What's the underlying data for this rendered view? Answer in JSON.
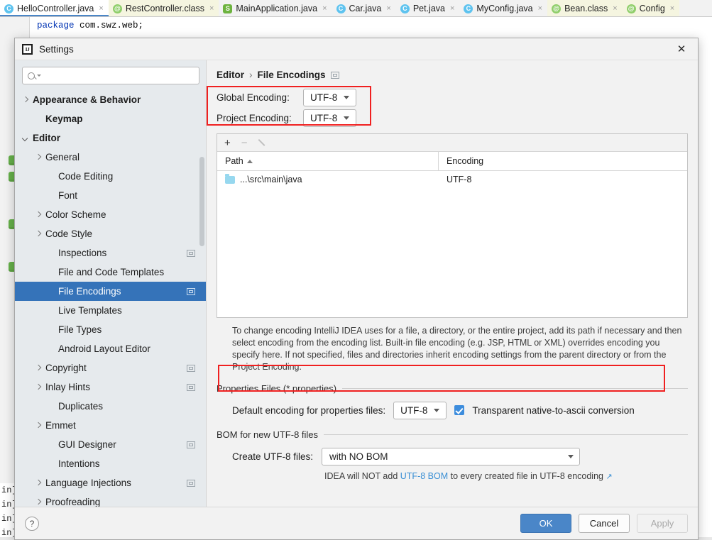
{
  "ide": {
    "tabs": [
      {
        "label": "HelloController.java",
        "icon": "class-c-icon",
        "kind": "java-active"
      },
      {
        "label": "RestController.class",
        "icon": "annotation-at-icon",
        "kind": "cls"
      },
      {
        "label": "MainApplication.java",
        "icon": "spring-boot-icon",
        "kind": "plain"
      },
      {
        "label": "Car.java",
        "icon": "class-c-icon",
        "kind": "plain"
      },
      {
        "label": "Pet.java",
        "icon": "class-c-icon",
        "kind": "plain"
      },
      {
        "label": "MyConfig.java",
        "icon": "class-c-icon",
        "kind": "plain"
      },
      {
        "label": "Bean.class",
        "icon": "annotation-at-icon",
        "kind": "cls"
      },
      {
        "label": "Config",
        "icon": "annotation-at-icon",
        "kind": "cls"
      }
    ],
    "close_glyph": "×",
    "code": {
      "keyword": "package",
      "rest": " com.swz.web;"
    },
    "console_lines": [
      "in]",
      "in]",
      "in]",
      "in]"
    ]
  },
  "dialog": {
    "title": "Settings",
    "logo_text": "IJ",
    "close_glyph": "✕"
  },
  "search": {
    "value": "",
    "placeholder": ""
  },
  "sidebar": {
    "items": [
      {
        "label": "Appearance & Behavior",
        "arrow": "right",
        "indent": 0,
        "bold": true,
        "badge": false,
        "selected": false
      },
      {
        "label": "Keymap",
        "arrow": "none",
        "indent": 1,
        "bold": true,
        "badge": false,
        "selected": false
      },
      {
        "label": "Editor",
        "arrow": "down",
        "indent": 0,
        "bold": true,
        "badge": false,
        "selected": false
      },
      {
        "label": "General",
        "arrow": "right",
        "indent": 1,
        "bold": false,
        "badge": false,
        "selected": false
      },
      {
        "label": "Code Editing",
        "arrow": "none",
        "indent": 2,
        "bold": false,
        "badge": false,
        "selected": false
      },
      {
        "label": "Font",
        "arrow": "none",
        "indent": 2,
        "bold": false,
        "badge": false,
        "selected": false
      },
      {
        "label": "Color Scheme",
        "arrow": "right",
        "indent": 1,
        "bold": false,
        "badge": false,
        "selected": false
      },
      {
        "label": "Code Style",
        "arrow": "right",
        "indent": 1,
        "bold": false,
        "badge": false,
        "selected": false
      },
      {
        "label": "Inspections",
        "arrow": "none",
        "indent": 2,
        "bold": false,
        "badge": true,
        "selected": false
      },
      {
        "label": "File and Code Templates",
        "arrow": "none",
        "indent": 2,
        "bold": false,
        "badge": false,
        "selected": false
      },
      {
        "label": "File Encodings",
        "arrow": "none",
        "indent": 2,
        "bold": false,
        "badge": true,
        "selected": true
      },
      {
        "label": "Live Templates",
        "arrow": "none",
        "indent": 2,
        "bold": false,
        "badge": false,
        "selected": false
      },
      {
        "label": "File Types",
        "arrow": "none",
        "indent": 2,
        "bold": false,
        "badge": false,
        "selected": false
      },
      {
        "label": "Android Layout Editor",
        "arrow": "none",
        "indent": 2,
        "bold": false,
        "badge": false,
        "selected": false
      },
      {
        "label": "Copyright",
        "arrow": "right",
        "indent": 1,
        "bold": false,
        "badge": true,
        "selected": false
      },
      {
        "label": "Inlay Hints",
        "arrow": "right",
        "indent": 1,
        "bold": false,
        "badge": true,
        "selected": false
      },
      {
        "label": "Duplicates",
        "arrow": "none",
        "indent": 2,
        "bold": false,
        "badge": false,
        "selected": false
      },
      {
        "label": "Emmet",
        "arrow": "right",
        "indent": 1,
        "bold": false,
        "badge": false,
        "selected": false
      },
      {
        "label": "GUI Designer",
        "arrow": "none",
        "indent": 2,
        "bold": false,
        "badge": true,
        "selected": false
      },
      {
        "label": "Intentions",
        "arrow": "none",
        "indent": 2,
        "bold": false,
        "badge": false,
        "selected": false
      },
      {
        "label": "Language Injections",
        "arrow": "right",
        "indent": 1,
        "bold": false,
        "badge": true,
        "selected": false
      },
      {
        "label": "Proofreading",
        "arrow": "right",
        "indent": 1,
        "bold": false,
        "badge": false,
        "selected": false
      }
    ]
  },
  "main": {
    "breadcrumb": {
      "root": "Editor",
      "separator": "›",
      "current": "File Encodings"
    },
    "global_encoding": {
      "label": "Global Encoding:",
      "value": "UTF‑8"
    },
    "project_encoding": {
      "label": "Project Encoding:",
      "value": "UTF‑8"
    },
    "toolbar": {
      "add": "+",
      "remove": "−",
      "edit_icon": "pencil-icon"
    },
    "table": {
      "columns": [
        "Path",
        "Encoding"
      ],
      "sort_column": "Path",
      "sort_direction": "asc",
      "rows": [
        {
          "path": "...\\src\\main\\java",
          "encoding": "UTF‑8"
        }
      ]
    },
    "description": "To change encoding IntelliJ IDEA uses for a file, a directory, or the entire project, add its path if necessary and then select encoding from the encoding list. Built‑in file encoding (e.g. JSP, HTML or XML) overrides encoding you specify here. If not specified, files and directories inherit encoding settings from the parent directory or from the Project Encoding.",
    "properties_section": {
      "title": "Properties Files (*.properties)",
      "default_encoding_label": "Default encoding for properties files:",
      "default_encoding_value": "UTF‑8",
      "checkbox_label": "Transparent native‑to‑ascii conversion",
      "checkbox_checked": true
    },
    "bom_section": {
      "title": "BOM for new UTF‑8 files",
      "create_label": "Create UTF‑8 files:",
      "create_value": "with NO BOM",
      "note_prefix": "IDEA will NOT add ",
      "note_link": "UTF‑8 BOM",
      "note_suffix": " to every created file in UTF‑8 encoding ",
      "note_ext_glyph": "↗"
    }
  },
  "footer": {
    "help": "?",
    "ok": "OK",
    "cancel": "Cancel",
    "apply": "Apply"
  },
  "colors": {
    "selection_blue": "#3573b9",
    "primary_button": "#4a86c8",
    "highlight_red": "#f02020",
    "link_blue": "#3a8fd4"
  }
}
